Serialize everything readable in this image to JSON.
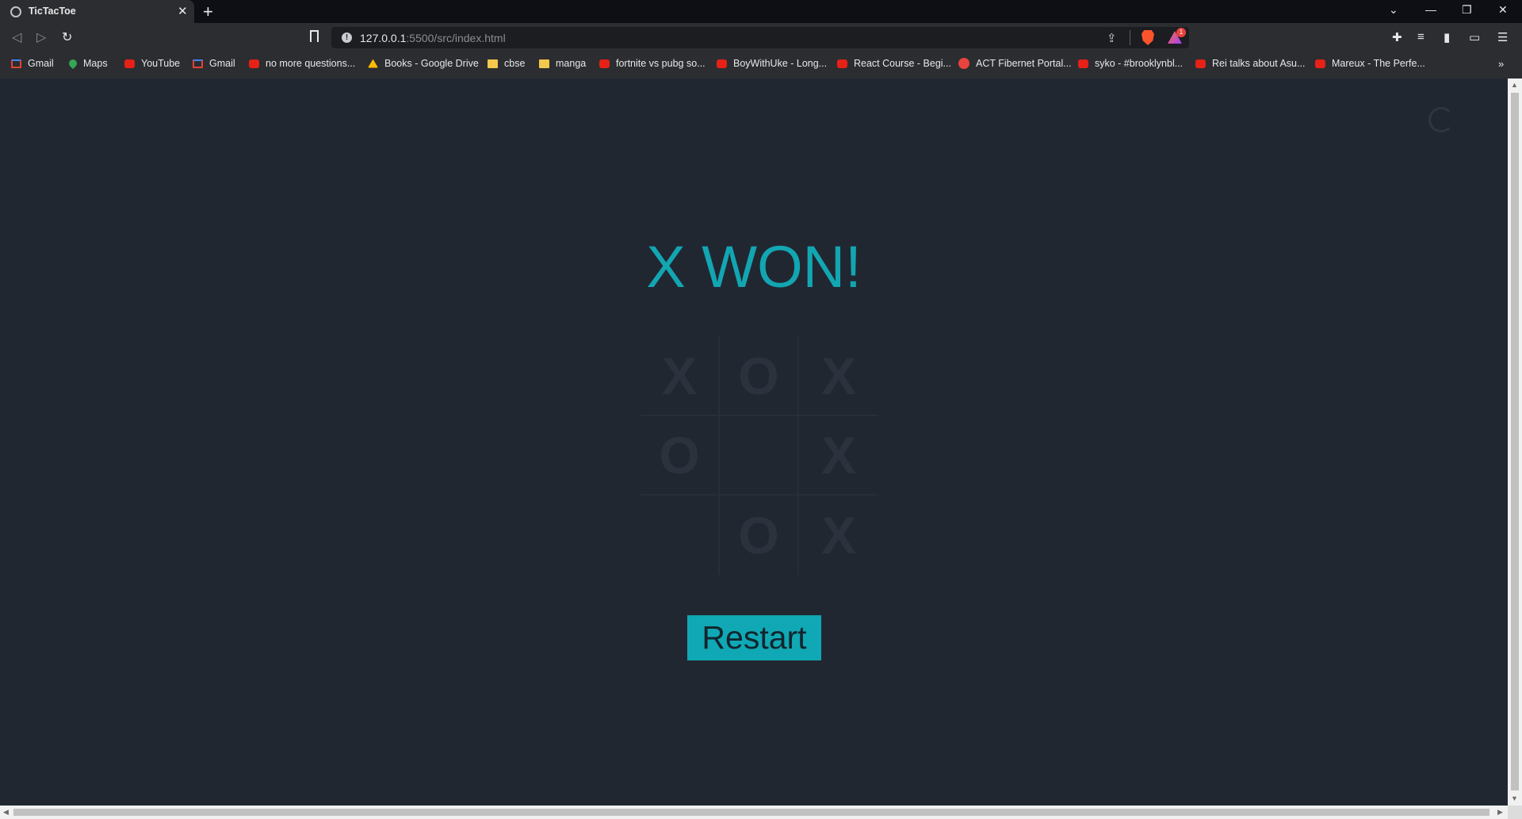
{
  "browser": {
    "tab_title": "TicTacToe",
    "url_host": "127.0.0.1",
    "url_path": ":5500/src/index.html",
    "rewards_badge": "1",
    "bookmarks": [
      {
        "label": "Gmail",
        "icon": "gmail-icon"
      },
      {
        "label": "Maps",
        "icon": "maps-icon"
      },
      {
        "label": "YouTube",
        "icon": "youtube-icon"
      },
      {
        "label": "Gmail",
        "icon": "gmail-icon"
      },
      {
        "label": "no more questions...",
        "icon": "youtube-icon"
      },
      {
        "label": "Books - Google Drive",
        "icon": "drive-icon"
      },
      {
        "label": "cbse",
        "icon": "folder-icon"
      },
      {
        "label": "manga",
        "icon": "folder-icon"
      },
      {
        "label": "fortnite vs pubg so...",
        "icon": "youtube-icon"
      },
      {
        "label": "BoyWithUke - Long...",
        "icon": "youtube-icon"
      },
      {
        "label": "React Course - Begi...",
        "icon": "youtube-icon"
      },
      {
        "label": "ACT Fibernet Portal...",
        "icon": "act-icon"
      },
      {
        "label": "syko - #brooklynbl...",
        "icon": "youtube-icon"
      },
      {
        "label": "Rei talks about Asu...",
        "icon": "youtube-icon"
      },
      {
        "label": "Mareux - The Perfe...",
        "icon": "youtube-icon"
      }
    ]
  },
  "game": {
    "status": "X WON!",
    "board": [
      "X",
      "O",
      "X",
      "O",
      "",
      "X",
      "",
      "O",
      "X"
    ],
    "restart_label": "Restart"
  },
  "colors": {
    "page_background": "#212731",
    "accent": "#12a6b2",
    "cell_mark": "#2b323d"
  }
}
